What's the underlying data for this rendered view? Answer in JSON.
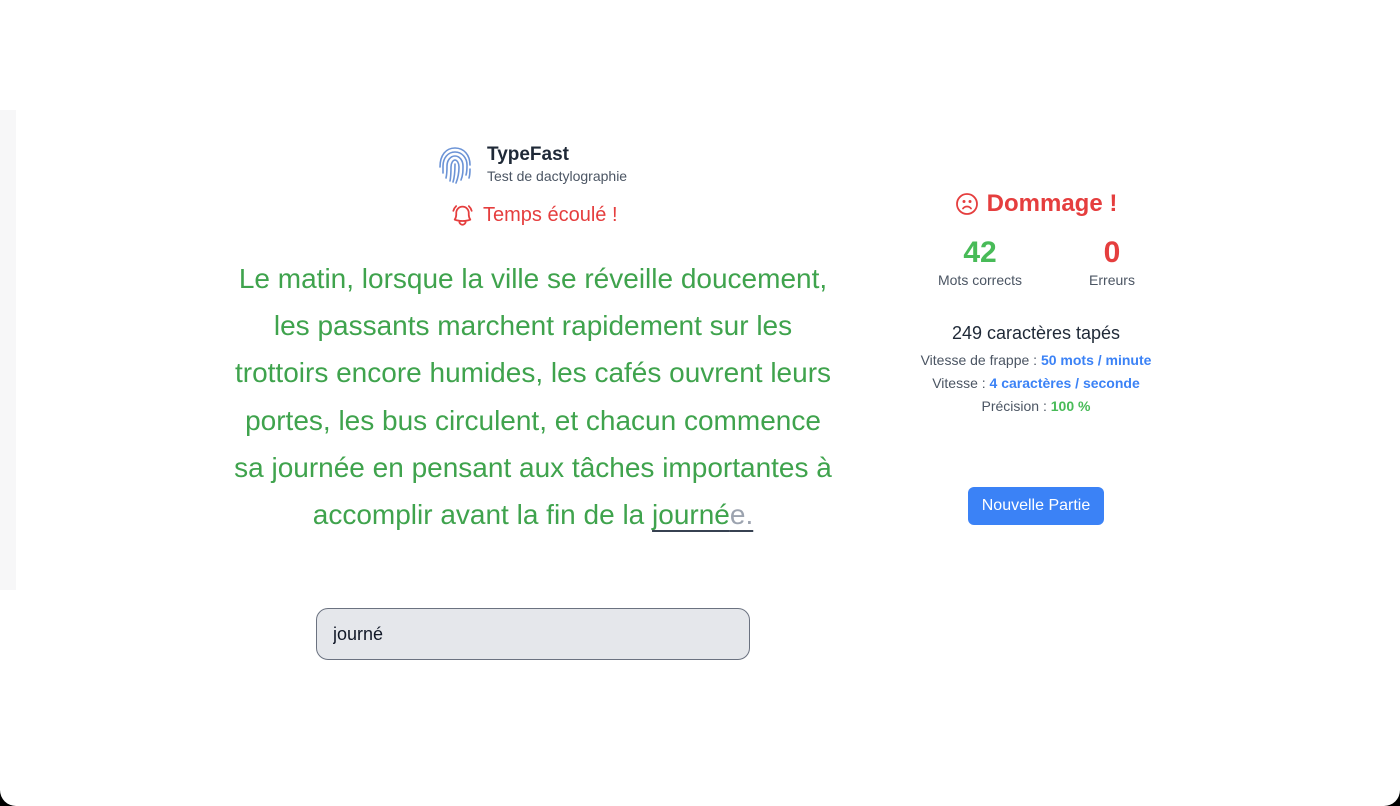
{
  "app": {
    "name": "TypeFast",
    "subtitle": "Test de dactylographie"
  },
  "timer": {
    "message": "Temps écoulé !"
  },
  "passage": {
    "completed_text": "Le matin, lorsque la ville se réveille doucement, les passants marchent rapidement sur les trottoirs encore humides, les cafés ouvrent leurs portes, les bus circulent, et chacun commence sa journée en pensant aux tâches importantes à accomplir avant la fin de la",
    "current_word_typed": "journé",
    "current_word_remaining": "e."
  },
  "input": {
    "value": "journé"
  },
  "result": {
    "title": "Dommage !",
    "correct_words_value": "42",
    "correct_words_label": "Mots corrects",
    "errors_value": "0",
    "errors_label": "Erreurs",
    "chars_typed": "249 caractères tapés",
    "speed_label": "Vitesse de frappe : ",
    "speed_value": "50 mots / minute",
    "cps_label": "Vitesse : ",
    "cps_value": "4 caractères / seconde",
    "accuracy_label": "Précision : ",
    "accuracy_value": "100 %"
  },
  "actions": {
    "new_game": "Nouvelle Partie"
  },
  "colors": {
    "correct_green": "#3fa34d",
    "error_red": "#e53e3e",
    "accent_blue": "#3b82f6",
    "pending_gray": "#9ca3af"
  },
  "icons": {
    "logo": "fingerprint-icon",
    "timer": "bell-alert-icon",
    "result": "sad-face-icon"
  }
}
